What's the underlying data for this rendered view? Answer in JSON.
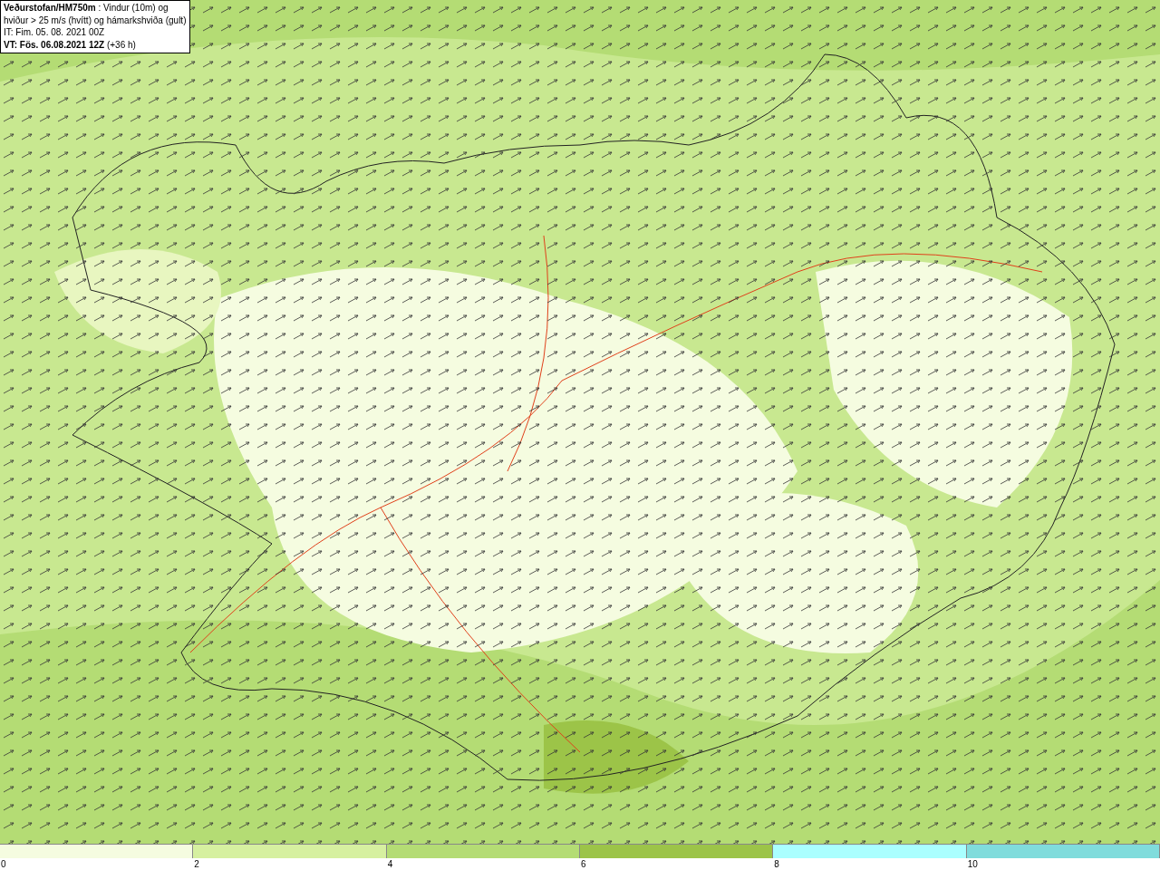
{
  "title_box": {
    "lines": [
      "**Veðurstofan/HM750m** : Vindur (10m) og",
      "hviður > 25 m/s (hvítt) og hámarkshviða (gult)",
      "IT: Fim. 05. 08. 2021 00Z",
      "**VT: Fös. 06.08.2021 12Z** (+36 h)"
    ]
  },
  "legend": {
    "segments": [
      {
        "color": "#f5fce0"
      },
      {
        "color": "#d6f0a0"
      },
      {
        "color": "#b4dc74"
      },
      {
        "color": "#9cc448"
      },
      {
        "color": "#aaffff"
      },
      {
        "color": "#80dcdc"
      }
    ],
    "labels": [
      "0",
      "2",
      "4",
      "6",
      "8",
      "10"
    ]
  }
}
